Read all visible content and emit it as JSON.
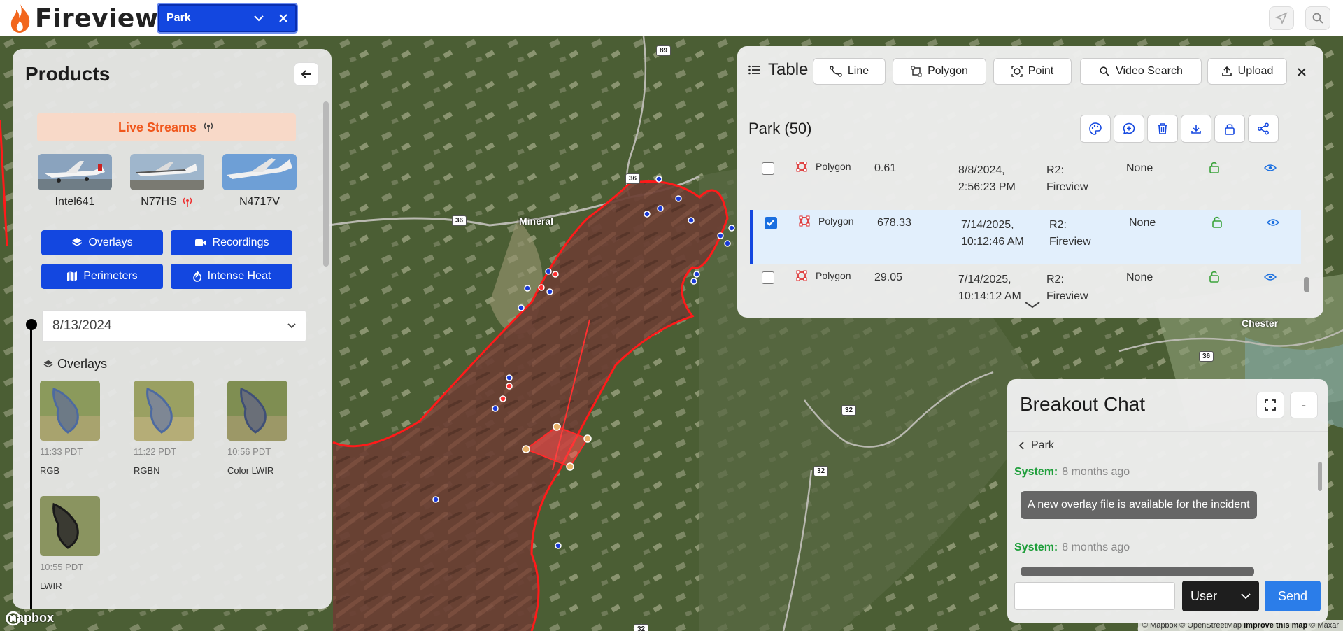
{
  "app": {
    "name": "Fireview"
  },
  "header": {
    "incident_selected": "Park"
  },
  "map": {
    "labels": {
      "mineral": "Mineral",
      "chester": "Chester"
    },
    "shields": [
      "89",
      "36",
      "36",
      "36",
      "36",
      "32",
      "32",
      "32"
    ],
    "mapbox": "mapbox",
    "attribution": {
      "mapbox": "© Mapbox",
      "osm": "© OpenStreetMap",
      "improve": "Improve this map",
      "maxar": "© Maxar"
    }
  },
  "products": {
    "title": "Products",
    "live_streams_label": "Live Streams",
    "aircraft": [
      {
        "name": "Intel641",
        "live": false
      },
      {
        "name": "N77HS",
        "live": true
      },
      {
        "name": "N4717V",
        "live": false
      }
    ],
    "buttons": {
      "overlays": "Overlays",
      "recordings": "Recordings",
      "perimeters": "Perimeters",
      "intense_heat": "Intense Heat"
    },
    "date": "8/13/2024",
    "overlays_heading": "Overlays",
    "overlays": [
      {
        "time": "11:33 PDT",
        "name": "RGB"
      },
      {
        "time": "11:22 PDT",
        "name": "RGBN"
      },
      {
        "time": "10:56 PDT",
        "name": "Color LWIR"
      },
      {
        "time": "10:55 PDT",
        "name": "LWIR"
      }
    ]
  },
  "table": {
    "title": "Table",
    "tools": {
      "line": "Line",
      "polygon": "Polygon",
      "point": "Point",
      "video_search": "Video Search",
      "upload": "Upload"
    },
    "subtitle": "Park (50)",
    "rows": [
      {
        "type": "Polygon",
        "value": "0.61",
        "date1": "8/8/2024,",
        "date2": "2:56:23 PM",
        "src1": "R2:",
        "src2": "Fireview",
        "status": "None",
        "checked": false
      },
      {
        "type": "Polygon",
        "value": "678.33",
        "date1": "7/14/2025,",
        "date2": "10:12:46 AM",
        "src1": "R2:",
        "src2": "Fireview",
        "status": "None",
        "checked": true
      },
      {
        "type": "Polygon",
        "value": "29.05",
        "date1": "7/14/2025,",
        "date2": "10:14:12 AM",
        "src1": "R2:",
        "src2": "Fireview",
        "status": "None",
        "checked": false
      }
    ]
  },
  "chat": {
    "title": "Breakout Chat",
    "minimize": "-",
    "crumb": "Park",
    "messages": [
      {
        "who": "System:",
        "when": "8 months ago",
        "text": "A new overlay file is available for the incident"
      },
      {
        "who": "System:",
        "when": "8 months ago",
        "text": ""
      }
    ],
    "role": "User",
    "send": "Send"
  },
  "colors": {
    "accent": "#1347e0",
    "fire": "#ff1a1a",
    "live": "#f0561b",
    "system": "#1e9e3a"
  }
}
